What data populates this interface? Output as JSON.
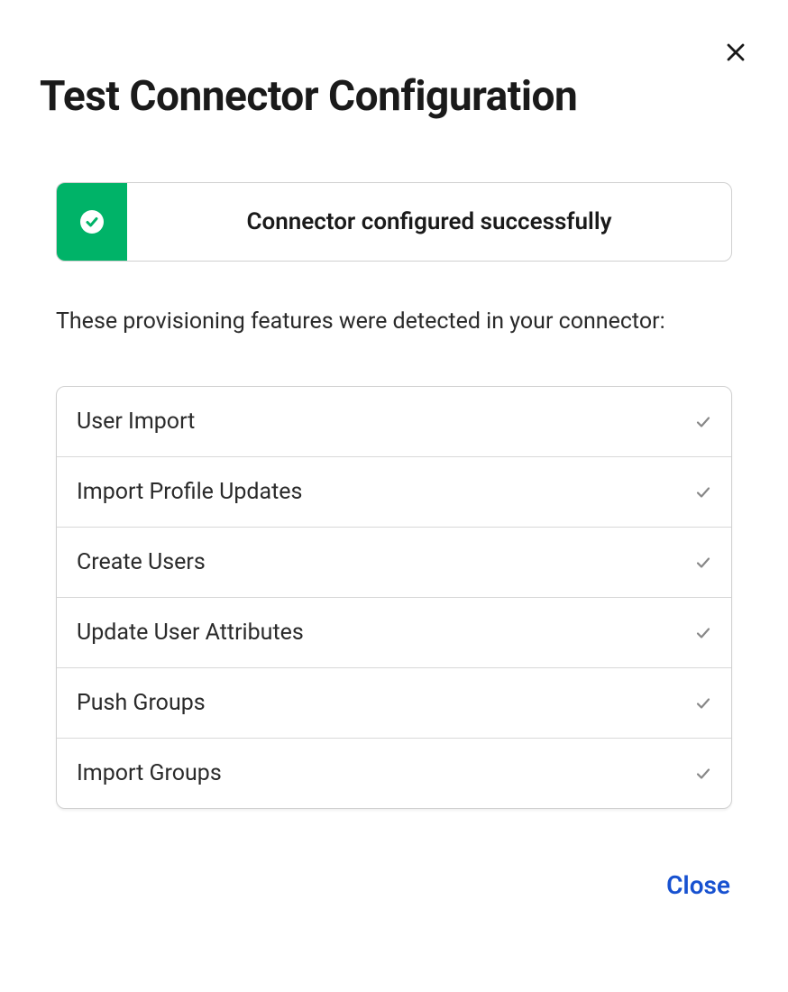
{
  "modal": {
    "title": "Test Connector Configuration",
    "status_message": "Connector configured successfully",
    "description": "These provisioning features were detected in your connector:",
    "features": [
      {
        "label": "User Import"
      },
      {
        "label": "Import Profile Updates"
      },
      {
        "label": "Create Users"
      },
      {
        "label": "Update User Attributes"
      },
      {
        "label": "Push Groups"
      },
      {
        "label": "Import Groups"
      }
    ],
    "close_label": "Close"
  }
}
